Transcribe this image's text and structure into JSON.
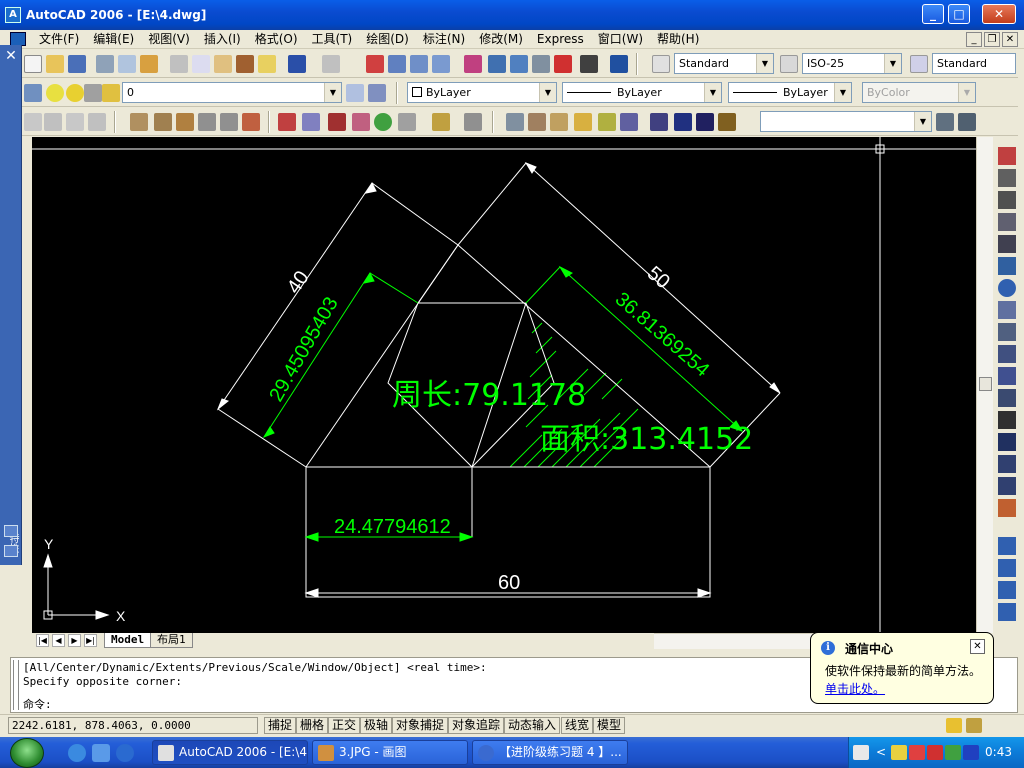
{
  "window": {
    "title": "AutoCAD 2006 - [E:\\4.dwg]"
  },
  "menu": {
    "items": [
      "文件(F)",
      "编辑(E)",
      "视图(V)",
      "插入(I)",
      "格式(O)",
      "工具(T)",
      "绘图(D)",
      "标注(N)",
      "修改(M)",
      "Express",
      "窗口(W)",
      "帮助(H)"
    ]
  },
  "toolbars": {
    "text_style": "Standard",
    "dim_style": "ISO-25",
    "table_style": "Standard",
    "layer": "0",
    "color": "ByLayer",
    "linetype": "ByLayer",
    "lineweight": "ByLayer",
    "plotstyle": "ByColor"
  },
  "left_palette": {
    "label": "特性"
  },
  "drawing": {
    "dim_top_left": "40",
    "dim_top_right": "50",
    "dim_inner_left": "29.45095403",
    "dim_inner_right": "36.81369254",
    "dim_bottom_left": "24.47794612",
    "dim_bottom": "60",
    "perimeter_label": "周长:79.1178",
    "area_label": "面积:313.4152",
    "ucs_x": "X",
    "ucs_y": "Y",
    "colors": {
      "white_lines": "#ffffff",
      "dim_green": "#00ff00",
      "canvas_bg": "#000000"
    }
  },
  "tabs": {
    "model": "Model",
    "layout1": "布局1"
  },
  "command": {
    "line1": "[All/Center/Dynamic/Extents/Previous/Scale/Window/Object] <real time>:",
    "line2": "Specify opposite corner:",
    "prompt": "命令:"
  },
  "status": {
    "coords": "2242.6181, 878.4063, 0.0000",
    "buttons": [
      "捕捉",
      "栅格",
      "正交",
      "极轴",
      "对象捕捉",
      "对象追踪",
      "动态输入",
      "线宽",
      "模型"
    ]
  },
  "balloon": {
    "title": "通信中心",
    "text": "使软件保持最新的简单方法。",
    "link": "单击此处。"
  },
  "taskbar": {
    "tasks": [
      {
        "label": "AutoCAD 2006 - [E:\\4..."
      },
      {
        "label": "3.JPG - 画图"
      },
      {
        "label": "【进阶级练习题 4 】..."
      }
    ],
    "clock": "0:43"
  }
}
